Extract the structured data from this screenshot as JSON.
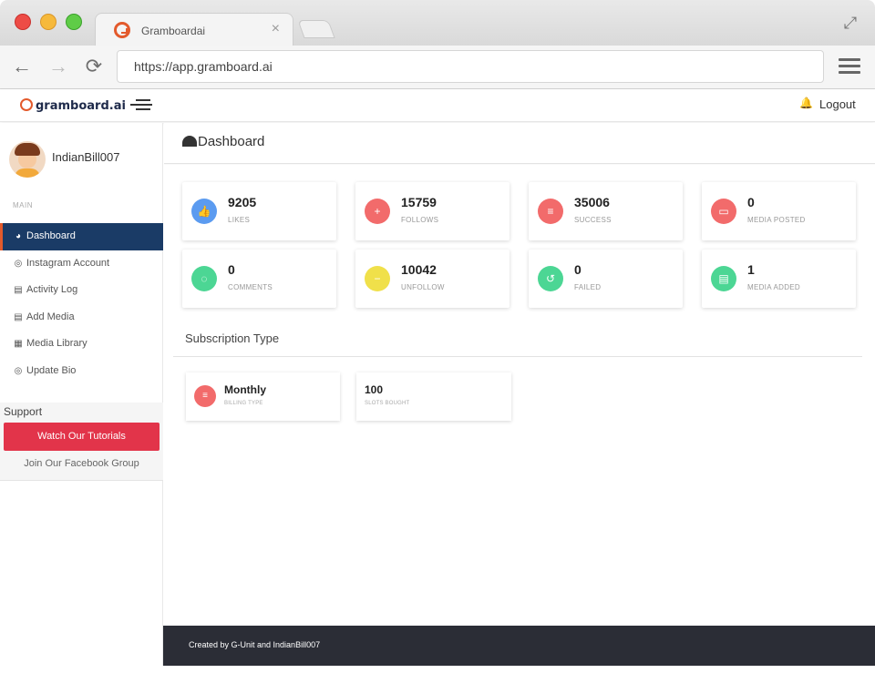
{
  "browser": {
    "tab_title": "Gramboardai",
    "tab_close": "×",
    "url": "https://app.gramboard.ai",
    "back_glyph": "←",
    "forward_glyph": "→",
    "reload_glyph": "⟳",
    "expand_glyph": "⤢"
  },
  "header": {
    "brand": "gramboard.ai",
    "logout_label": "Logout",
    "bell_glyph": "🔔"
  },
  "sidebar": {
    "username": "IndianBill007",
    "section_label": "MAIN",
    "items": [
      {
        "label": "Dashboard",
        "icon": "◕",
        "icon_name": "dashboard-icon"
      },
      {
        "label": "Instagram Account",
        "icon": "◎",
        "icon_name": "instagram-icon"
      },
      {
        "label": "Activity Log",
        "icon": "▤",
        "icon_name": "document-icon"
      },
      {
        "label": "Add Media",
        "icon": "▤",
        "icon_name": "add-file-icon"
      },
      {
        "label": "Media Library",
        "icon": "▦",
        "icon_name": "images-icon"
      },
      {
        "label": "Update Bio",
        "icon": "◎",
        "icon_name": "instagram-icon"
      }
    ],
    "support": {
      "title": "Support",
      "tutorial_button": "Watch Our Tutorials",
      "facebook_link": "Join Our Facebook Group"
    }
  },
  "page": {
    "title": "Dashboard"
  },
  "stats": [
    {
      "value": "9205",
      "label": "LIKES",
      "color": "#5b9bf0",
      "icon": "👍",
      "icon_name": "thumbs-up-icon"
    },
    {
      "value": "15759",
      "label": "FOLLOWS",
      "color": "#f26b6b",
      "icon": "+",
      "icon_name": "add-user-icon"
    },
    {
      "value": "35006",
      "label": "SUCCESS",
      "color": "#f26b6b",
      "icon": "≡",
      "icon_name": "checklist-icon"
    },
    {
      "value": "0",
      "label": "MEDIA POSTED",
      "color": "#f26b6b",
      "icon": "▭",
      "icon_name": "media-icon"
    },
    {
      "value": "0",
      "label": "COMMENTS",
      "color": "#4cd694",
      "icon": "◌",
      "icon_name": "comments-icon"
    },
    {
      "value": "10042",
      "label": "UNFOLLOW",
      "color": "#f0e04a",
      "icon": "−",
      "icon_name": "minus-circle-icon"
    },
    {
      "value": "0",
      "label": "FAILED",
      "color": "#4cd694",
      "icon": "↺",
      "icon_name": "undo-icon"
    },
    {
      "value": "1",
      "label": "MEDIA ADDED",
      "color": "#4cd694",
      "icon": "▤",
      "icon_name": "file-icon"
    }
  ],
  "subscription": {
    "title": "Subscription Type",
    "billing_value": "Monthly",
    "billing_label": "BILLING TYPE",
    "slots_value": "100",
    "slots_label": "SLOTS BOUGHT",
    "icon": "≡"
  },
  "footer": {
    "text": "Created by G-Unit and IndianBill007"
  }
}
